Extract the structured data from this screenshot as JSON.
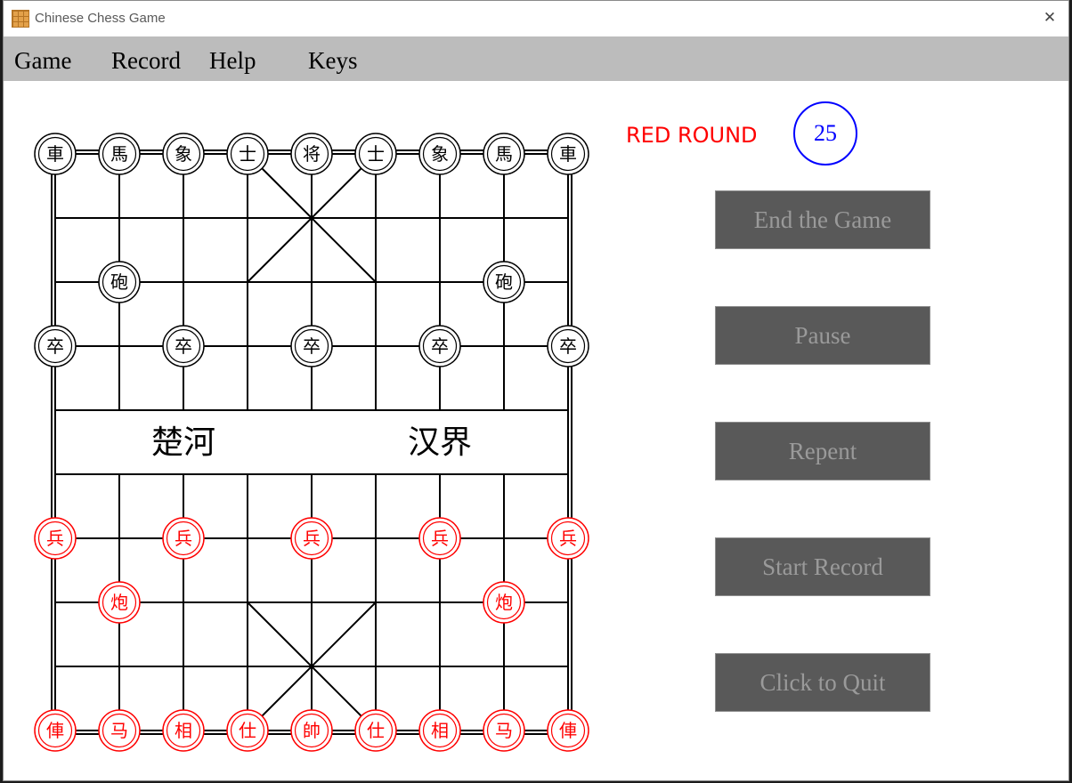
{
  "window": {
    "title": "Chinese Chess Game",
    "icon": "chessboard-icon",
    "close_icon": "close-icon",
    "close_glyph": "✕"
  },
  "menu": {
    "items": [
      "Game",
      "Record",
      "Help",
      "Keys"
    ]
  },
  "board": {
    "river_left": "楚河",
    "river_right": "汉界",
    "colors": {
      "line": "#000000",
      "black_piece": "#000000",
      "red_piece": "#ff0000"
    },
    "pieces": [
      {
        "char": "車",
        "side": "black",
        "col": 0,
        "row": 0
      },
      {
        "char": "馬",
        "side": "black",
        "col": 1,
        "row": 0
      },
      {
        "char": "象",
        "side": "black",
        "col": 2,
        "row": 0
      },
      {
        "char": "士",
        "side": "black",
        "col": 3,
        "row": 0
      },
      {
        "char": "将",
        "side": "black",
        "col": 4,
        "row": 0
      },
      {
        "char": "士",
        "side": "black",
        "col": 5,
        "row": 0
      },
      {
        "char": "象",
        "side": "black",
        "col": 6,
        "row": 0
      },
      {
        "char": "馬",
        "side": "black",
        "col": 7,
        "row": 0
      },
      {
        "char": "車",
        "side": "black",
        "col": 8,
        "row": 0
      },
      {
        "char": "砲",
        "side": "black",
        "col": 1,
        "row": 2
      },
      {
        "char": "砲",
        "side": "black",
        "col": 7,
        "row": 2
      },
      {
        "char": "卒",
        "side": "black",
        "col": 0,
        "row": 3
      },
      {
        "char": "卒",
        "side": "black",
        "col": 2,
        "row": 3
      },
      {
        "char": "卒",
        "side": "black",
        "col": 4,
        "row": 3
      },
      {
        "char": "卒",
        "side": "black",
        "col": 6,
        "row": 3
      },
      {
        "char": "卒",
        "side": "black",
        "col": 8,
        "row": 3
      },
      {
        "char": "兵",
        "side": "red",
        "col": 0,
        "row": 6
      },
      {
        "char": "兵",
        "side": "red",
        "col": 2,
        "row": 6
      },
      {
        "char": "兵",
        "side": "red",
        "col": 4,
        "row": 6
      },
      {
        "char": "兵",
        "side": "red",
        "col": 6,
        "row": 6
      },
      {
        "char": "兵",
        "side": "red",
        "col": 8,
        "row": 6
      },
      {
        "char": "炮",
        "side": "red",
        "col": 1,
        "row": 7
      },
      {
        "char": "炮",
        "side": "red",
        "col": 7,
        "row": 7
      },
      {
        "char": "俥",
        "side": "red",
        "col": 0,
        "row": 9
      },
      {
        "char": "马",
        "side": "red",
        "col": 1,
        "row": 9
      },
      {
        "char": "相",
        "side": "red",
        "col": 2,
        "row": 9
      },
      {
        "char": "仕",
        "side": "red",
        "col": 3,
        "row": 9
      },
      {
        "char": "帥",
        "side": "red",
        "col": 4,
        "row": 9
      },
      {
        "char": "仕",
        "side": "red",
        "col": 5,
        "row": 9
      },
      {
        "char": "相",
        "side": "red",
        "col": 6,
        "row": 9
      },
      {
        "char": "马",
        "side": "red",
        "col": 7,
        "row": 9
      },
      {
        "char": "俥",
        "side": "red",
        "col": 8,
        "row": 9
      }
    ]
  },
  "status": {
    "round_label": "RED ROUND",
    "round_number": "25",
    "round_label_color": "#ff0000",
    "round_number_color": "#0000ff"
  },
  "buttons": [
    {
      "label": "End the Game",
      "name": "end-game-button"
    },
    {
      "label": "Pause",
      "name": "pause-button"
    },
    {
      "label": "Repent",
      "name": "repent-button"
    },
    {
      "label": "Start Record",
      "name": "start-record-button"
    },
    {
      "label": "Click to Quit",
      "name": "quit-button"
    }
  ]
}
